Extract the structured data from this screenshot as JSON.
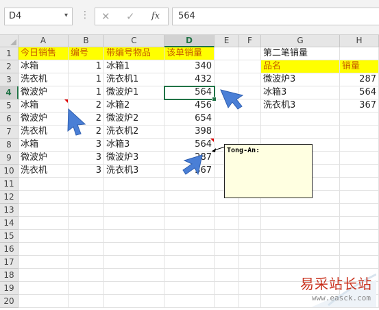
{
  "formula_bar": {
    "name_box": "D4",
    "dropdown_glyph": "▾",
    "separator": "⋮",
    "cancel_icon": "✕",
    "enter_icon": "✓",
    "fx_label": "fx",
    "value": "564"
  },
  "columns": [
    "A",
    "B",
    "C",
    "D",
    "E",
    "F",
    "G",
    "H"
  ],
  "rows": [
    "1",
    "2",
    "3",
    "4",
    "5",
    "6",
    "7",
    "8",
    "9",
    "10",
    "11",
    "12",
    "13",
    "14",
    "15",
    "16",
    "17",
    "18",
    "19",
    "20"
  ],
  "sheet": {
    "headers": [
      "今日销售",
      "编号",
      "带编号物品",
      "该单销量"
    ],
    "records": [
      [
        "冰箱",
        "1",
        "冰箱1",
        "340"
      ],
      [
        "洗衣机",
        "1",
        "洗衣机1",
        "432"
      ],
      [
        "微波炉",
        "1",
        "微波炉1",
        "564"
      ],
      [
        "冰箱",
        "2",
        "冰箱2",
        "456"
      ],
      [
        "微波炉",
        "2",
        "微波炉2",
        "654"
      ],
      [
        "洗衣机",
        "2",
        "洗衣机2",
        "398"
      ],
      [
        "冰箱",
        "3",
        "冰箱3",
        "564"
      ],
      [
        "微波炉",
        "3",
        "微波炉3",
        "287"
      ],
      [
        "洗衣机",
        "3",
        "洗衣机3",
        "367"
      ]
    ],
    "side_title": "第二笔销量",
    "side_headers": [
      "品名",
      "销量"
    ],
    "side_records": [
      [
        "微波炉3",
        "287"
      ],
      [
        "冰箱3",
        "564"
      ],
      [
        "洗衣机3",
        "367"
      ]
    ]
  },
  "comment": {
    "author": "Tong-An:"
  },
  "watermark": {
    "title": "易采站长站",
    "url": "www.easck.com"
  },
  "colors": {
    "header_fill": "#ffff00",
    "header_text": "#c65b00",
    "selection": "#217346",
    "cursor": "#4a7fd6"
  }
}
